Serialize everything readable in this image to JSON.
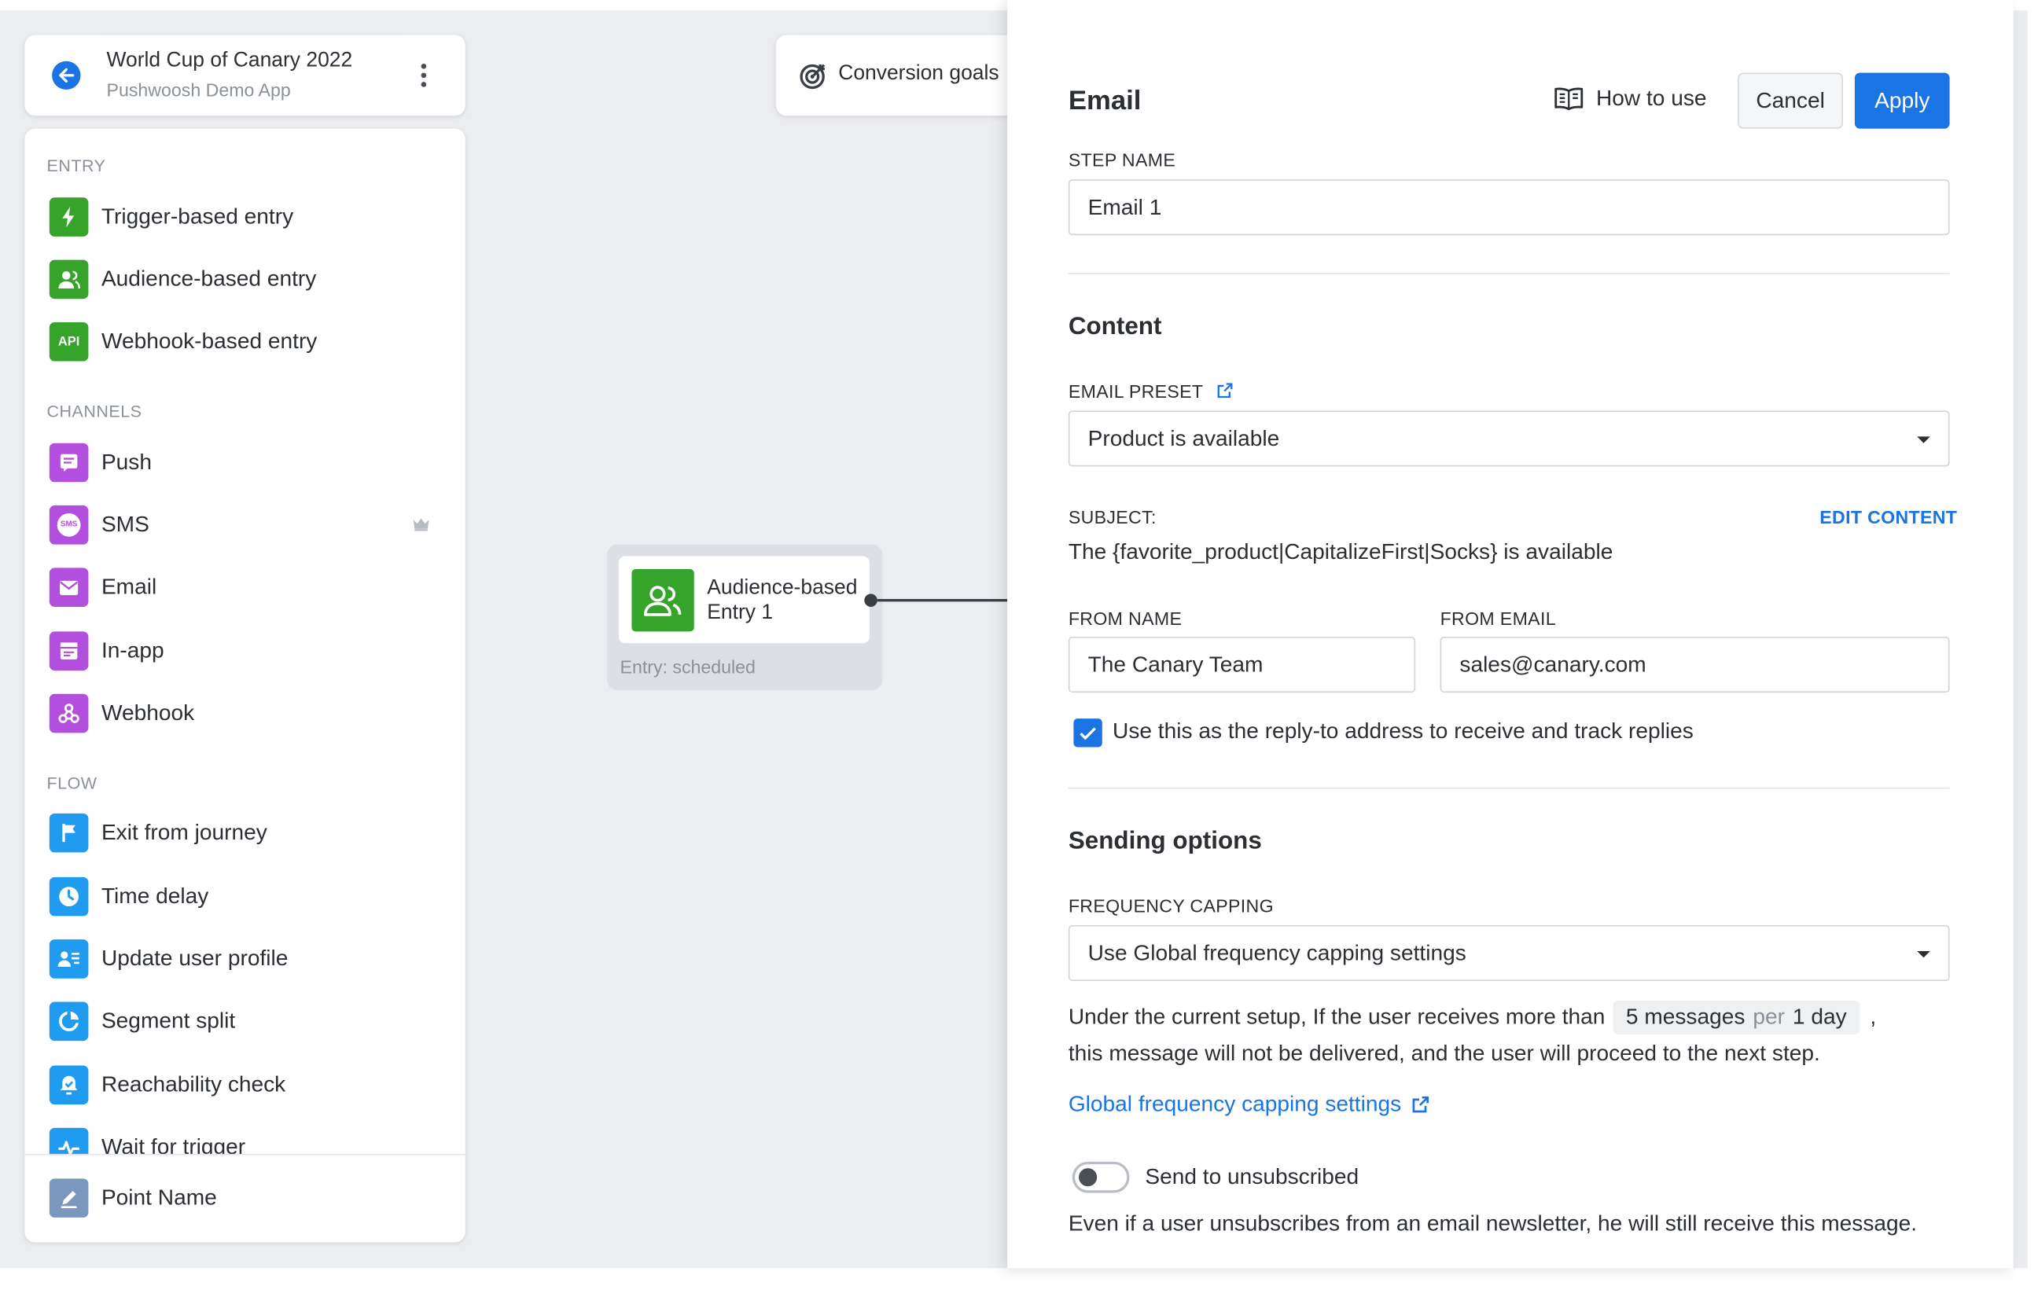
{
  "journey": {
    "title": "World Cup of Canary 2022",
    "subtitle": "Pushwoosh Demo App"
  },
  "palette": {
    "sections": {
      "entry": "ENTRY",
      "channels": "CHANNELS",
      "flow": "FLOW"
    },
    "entry": [
      "Trigger-based entry",
      "Audience-based entry",
      "Webhook-based entry"
    ],
    "channels": [
      "Push",
      "SMS",
      "Email",
      "In-app",
      "Webhook"
    ],
    "flow": [
      "Exit from journey",
      "Time delay",
      "Update user profile",
      "Segment split",
      "Reachability check",
      "Wait for trigger"
    ],
    "footer": "Point Name",
    "api_icon_text": "API",
    "sms_icon_text": "SMS"
  },
  "canvas": {
    "conversion_goals": "Conversion goals",
    "node": {
      "title": "Audience-based Entry 1",
      "status": "Entry: scheduled"
    }
  },
  "panel": {
    "title": "Email",
    "how_to_use": "How to use",
    "cancel": "Cancel",
    "apply": "Apply",
    "step_name_label": "STEP NAME",
    "step_name_value": "Email 1",
    "content_heading": "Content",
    "email_preset_label": "EMAIL PRESET",
    "email_preset_value": "Product is available",
    "subject_label": "SUBJECT:",
    "edit_content": "EDIT CONTENT",
    "subject_value": "The {favorite_product|CapitalizeFirst|Socks} is available",
    "from_name_label": "FROM NAME",
    "from_name_value": "The Canary Team",
    "from_email_label": "FROM EMAIL",
    "from_email_value": "sales@canary.com",
    "reply_to_label": "Use this as the reply-to address to receive and track replies",
    "reply_to_checked": true,
    "sending_heading": "Sending options",
    "freq_label": "FREQUENCY CAPPING",
    "freq_value": "Use Global frequency capping settings",
    "note_prefix": "Under the current setup, If the user receives more than",
    "note_messages": "5 messages",
    "note_per": "per",
    "note_period": "1 day",
    "note_comma": ",",
    "note_line2": "this message will not be delivered, and the user will proceed to the next step.",
    "global_link": "Global frequency capping settings",
    "send_unsub_label": "Send to unsubscribed",
    "send_unsub_on": false,
    "send_unsub_desc": "Even if a user unsubscribes from an email newsletter, he will still receive this message."
  },
  "colors": {
    "accent": "#1b74e4",
    "entry_green": "#36a32a",
    "channel_purple": "#b24fde",
    "flow_blue": "#1f9bf0",
    "canvas_bg": "#ebedf0"
  }
}
